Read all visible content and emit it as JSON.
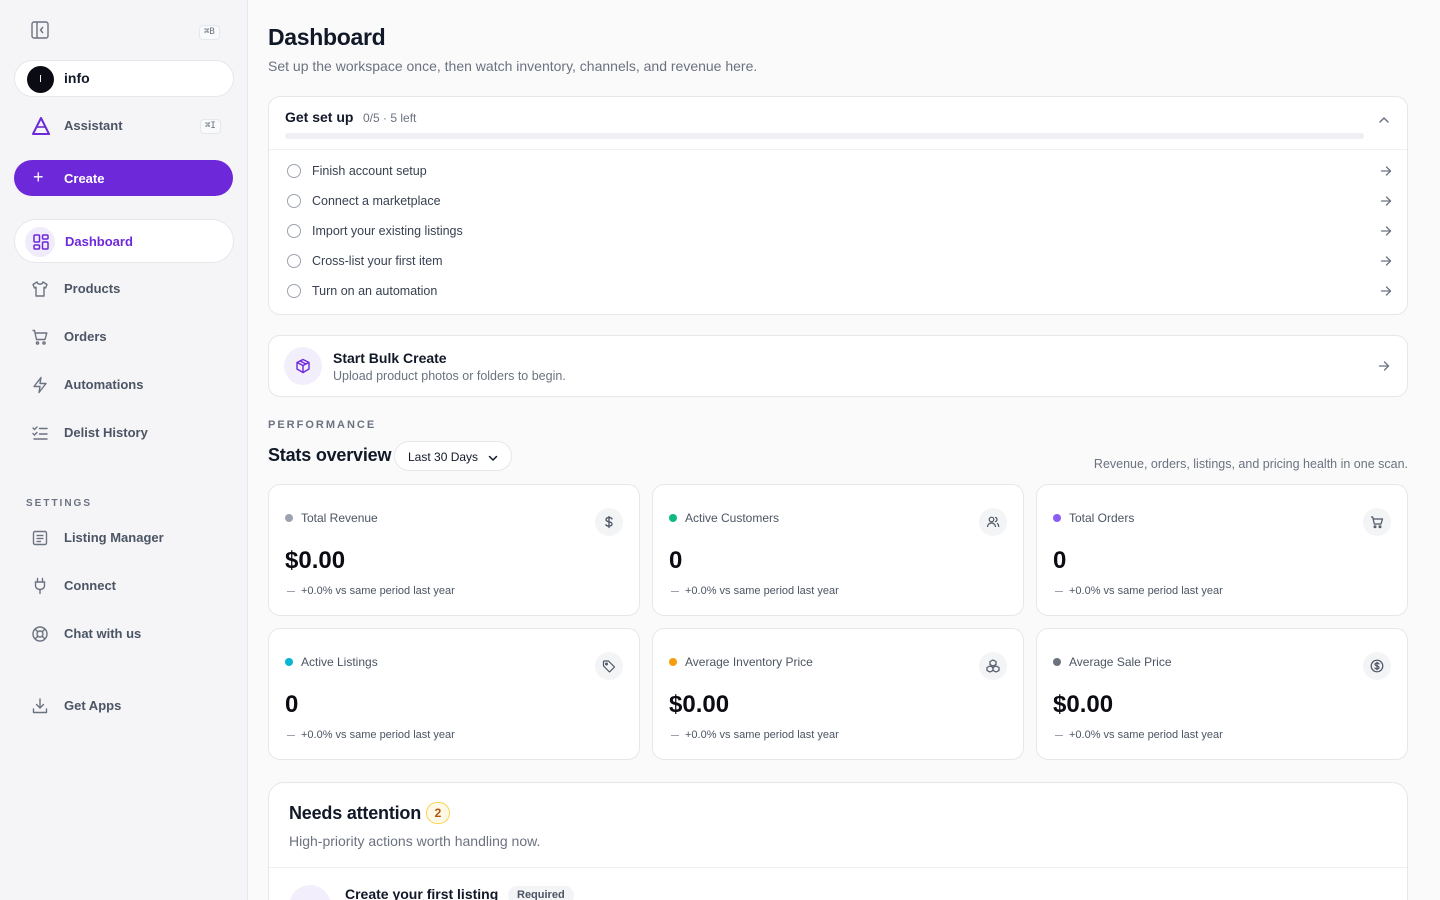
{
  "sidebar": {
    "collapse_shortcut": "⌘B",
    "profile": {
      "initial": "I",
      "name": "info"
    },
    "assistant": {
      "label": "Assistant",
      "shortcut": "⌘I"
    },
    "create_label": "Create",
    "nav": [
      {
        "label": "Dashboard",
        "icon": "grid-icon",
        "active": true
      },
      {
        "label": "Products",
        "icon": "shirt-icon"
      },
      {
        "label": "Orders",
        "icon": "cart-icon"
      },
      {
        "label": "Automations",
        "icon": "lightning-icon"
      },
      {
        "label": "Delist History",
        "icon": "checklist-icon"
      }
    ],
    "settings_label": "SETTINGS",
    "settings": [
      {
        "label": "Listing Manager",
        "icon": "document-icon"
      },
      {
        "label": "Connect",
        "icon": "plug-icon"
      },
      {
        "label": "Chat with us",
        "icon": "lifebuoy-icon"
      }
    ],
    "get_apps": {
      "label": "Get Apps",
      "icon": "download-icon"
    }
  },
  "header": {
    "title": "Dashboard",
    "subtitle": "Set up the workspace once, then watch inventory, channels, and revenue here."
  },
  "setup": {
    "title": "Get set up",
    "count": "0/5 · 5 left",
    "progress": 0,
    "tasks": [
      "Finish account setup",
      "Connect a marketplace",
      "Import your existing listings",
      "Cross-list your first item",
      "Turn on an automation"
    ]
  },
  "bulk": {
    "title": "Start Bulk Create",
    "subtitle": "Upload product photos or folders to begin."
  },
  "stats": {
    "section_label": "PERFORMANCE",
    "title": "Stats overview",
    "range": "Last 30 Days",
    "description": "Revenue, orders, listings, and pricing health in one scan.",
    "cards": [
      {
        "label": "Total Revenue",
        "value": "$0.00",
        "change": "+0.0% vs same period last year",
        "dot": "#9ca3af",
        "icon": "dollar-icon"
      },
      {
        "label": "Active Customers",
        "value": "0",
        "change": "+0.0% vs same period last year",
        "dot": "#10b981",
        "icon": "users-icon"
      },
      {
        "label": "Total Orders",
        "value": "0",
        "change": "+0.0% vs same period last year",
        "dot": "#8b5cf6",
        "icon": "cart-icon"
      },
      {
        "label": "Active Listings",
        "value": "0",
        "change": "+0.0% vs same period last year",
        "dot": "#06b6d4",
        "icon": "tag-icon"
      },
      {
        "label": "Average Inventory Price",
        "value": "$0.00",
        "change": "+0.0% vs same period last year",
        "dot": "#f59e0b",
        "icon": "boxes-icon"
      },
      {
        "label": "Average Sale Price",
        "value": "$0.00",
        "change": "+0.0% vs same period last year",
        "dot": "#6b7280",
        "icon": "coin-icon"
      }
    ]
  },
  "attention": {
    "title": "Needs attention",
    "count": "2",
    "subtitle": "High-priority actions worth handling now.",
    "first_item": {
      "title": "Create your first listing",
      "badge": "Required"
    }
  },
  "colors": {
    "accent": "#6d28d9"
  }
}
